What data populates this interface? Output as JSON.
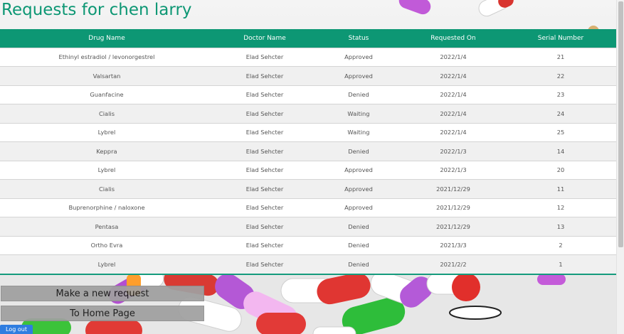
{
  "page": {
    "title": "Requests for chen larry"
  },
  "table": {
    "headers": [
      "Drug Name",
      "Doctor Name",
      "Status",
      "Requested On",
      "Serial Number"
    ],
    "rows": [
      [
        "Ethinyl estradiol / levonorgestrel",
        "Elad Sehcter",
        "Approved",
        "2022/1/4",
        "21"
      ],
      [
        "Valsartan",
        "Elad Sehcter",
        "Approved",
        "2022/1/4",
        "22"
      ],
      [
        "Guanfacine",
        "Elad Sehcter",
        "Denied",
        "2022/1/4",
        "23"
      ],
      [
        "Cialis",
        "Elad Sehcter",
        "Waiting",
        "2022/1/4",
        "24"
      ],
      [
        "Lybrel",
        "Elad Sehcter",
        "Waiting",
        "2022/1/4",
        "25"
      ],
      [
        "Keppra",
        "Elad Sehcter",
        "Denied",
        "2022/1/3",
        "14"
      ],
      [
        "Lybrel",
        "Elad Sehcter",
        "Approved",
        "2022/1/3",
        "20"
      ],
      [
        "Cialis",
        "Elad Sehcter",
        "Approved",
        "2021/12/29",
        "11"
      ],
      [
        "Buprenorphine / naloxone",
        "Elad Sehcter",
        "Approved",
        "2021/12/29",
        "12"
      ],
      [
        "Pentasa",
        "Elad Sehcter",
        "Denied",
        "2021/12/29",
        "13"
      ],
      [
        "Ortho Evra",
        "Elad Sehcter",
        "Denied",
        "2021/3/3",
        "2"
      ],
      [
        "Lybrel",
        "Elad Sehcter",
        "Denied",
        "2021/2/2",
        "1"
      ]
    ]
  },
  "buttons": {
    "new_request": "Make a new request",
    "home": "To Home Page",
    "logout": "Log out"
  },
  "colors": {
    "accent": "#0d9774",
    "header_bg": "#0d9774",
    "button_bg": "#a0a0a0",
    "logout_bg": "#2f7de0"
  }
}
